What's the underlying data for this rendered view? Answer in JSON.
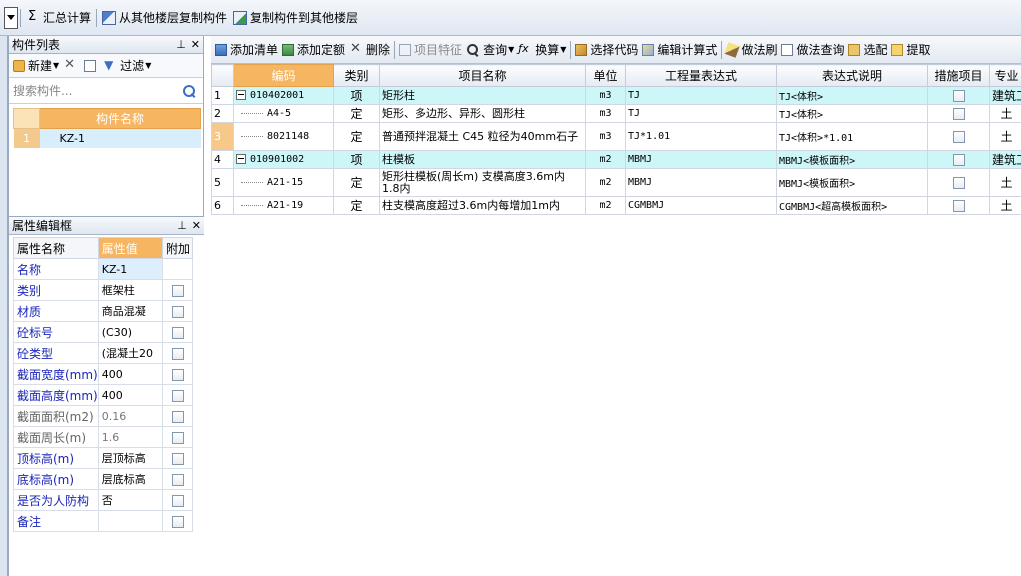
{
  "top_toolbar": {
    "sum_label": "汇总计算",
    "copy_from_label": "从其他楼层复制构件",
    "copy_to_label": "复制构件到其他楼层"
  },
  "component_list": {
    "title": "构件列表",
    "new_label": "新建",
    "filter_label": "过滤",
    "search_placeholder": "搜索构件...",
    "column_header": "构件名称",
    "rows": [
      {
        "index": "1",
        "name": "KZ-1"
      }
    ]
  },
  "attr_panel": {
    "title": "属性编辑框",
    "headers": {
      "name": "属性名称",
      "value": "属性值",
      "extra": "附加"
    },
    "rows": [
      {
        "name": "名称",
        "value": "KZ-1",
        "gray": false,
        "checkbox": false
      },
      {
        "name": "类别",
        "value": "框架柱",
        "gray": false,
        "checkbox": true
      },
      {
        "name": "材质",
        "value": "商品混凝",
        "gray": false,
        "checkbox": true
      },
      {
        "name": "砼标号",
        "value": "(C30)",
        "gray": false,
        "checkbox": true
      },
      {
        "name": "砼类型",
        "value": "(混凝土20",
        "gray": false,
        "checkbox": true
      },
      {
        "name": "截面宽度(mm)",
        "value": "400",
        "gray": false,
        "checkbox": true
      },
      {
        "name": "截面高度(mm)",
        "value": "400",
        "gray": false,
        "checkbox": true
      },
      {
        "name": "截面面积(m2)",
        "value": "0.16",
        "gray": true,
        "checkbox": true
      },
      {
        "name": "截面周长(m)",
        "value": "1.6",
        "gray": true,
        "checkbox": true
      },
      {
        "name": "顶标高(m)",
        "value": "层顶标高",
        "gray": false,
        "checkbox": true
      },
      {
        "name": "底标高(m)",
        "value": "层底标高",
        "gray": false,
        "checkbox": true
      },
      {
        "name": "是否为人防构",
        "value": "否",
        "gray": false,
        "checkbox": true
      },
      {
        "name": "备注",
        "value": "",
        "gray": false,
        "checkbox": true
      }
    ]
  },
  "right_toolbar": {
    "add_list": "添加清单",
    "add_quota": "添加定额",
    "delete": "删除",
    "item_feature": "项目特征",
    "query": "查询",
    "convert": "换算",
    "select_code": "选择代码",
    "edit_formula": "编辑计算式",
    "method_brush": "做法刷",
    "method_query": "做法查询",
    "match": "选配",
    "extract": "提取"
  },
  "grid": {
    "headers": [
      "编码",
      "类别",
      "项目名称",
      "单位",
      "工程量表达式",
      "表达式说明",
      "措施项目",
      "专业"
    ],
    "rows": [
      {
        "rn": "1",
        "type": "item",
        "code": "010402001",
        "category": "项",
        "name": "矩形柱",
        "unit": "m3",
        "expr": "TJ",
        "desc": "TJ<体积>",
        "major": "建筑工"
      },
      {
        "rn": "2",
        "type": "quota",
        "code": "A4-5",
        "category": "定",
        "name": "矩形、多边形、异形、圆形柱",
        "unit": "m3",
        "expr": "TJ",
        "desc": "TJ<体积>",
        "major": "土"
      },
      {
        "rn": "3",
        "type": "quota",
        "code": "8021148",
        "category": "定",
        "name": "普通预拌混凝土 C45 粒径为40mm石子",
        "unit": "m3",
        "expr": "TJ*1.01",
        "desc": "TJ<体积>*1.01",
        "major": "土"
      },
      {
        "rn": "4",
        "type": "item",
        "code": "010901002",
        "category": "项",
        "name": "柱模板",
        "unit": "m2",
        "expr": "MBMJ",
        "desc": "MBMJ<模板面积>",
        "major": "建筑工"
      },
      {
        "rn": "5",
        "type": "quota",
        "code": "A21-15",
        "category": "定",
        "name": "矩形柱模板(周长m) 支模高度3.6m内  1.8内",
        "unit": "m2",
        "expr": "MBMJ",
        "desc": "MBMJ<模板面积>",
        "major": "土"
      },
      {
        "rn": "6",
        "type": "quota",
        "code": "A21-19",
        "category": "定",
        "name": "柱支模高度超过3.6m内每增加1m内",
        "unit": "m2",
        "expr": "CGMBMJ",
        "desc": "CGMBMJ<超高模板面积>",
        "major": "土"
      }
    ]
  }
}
